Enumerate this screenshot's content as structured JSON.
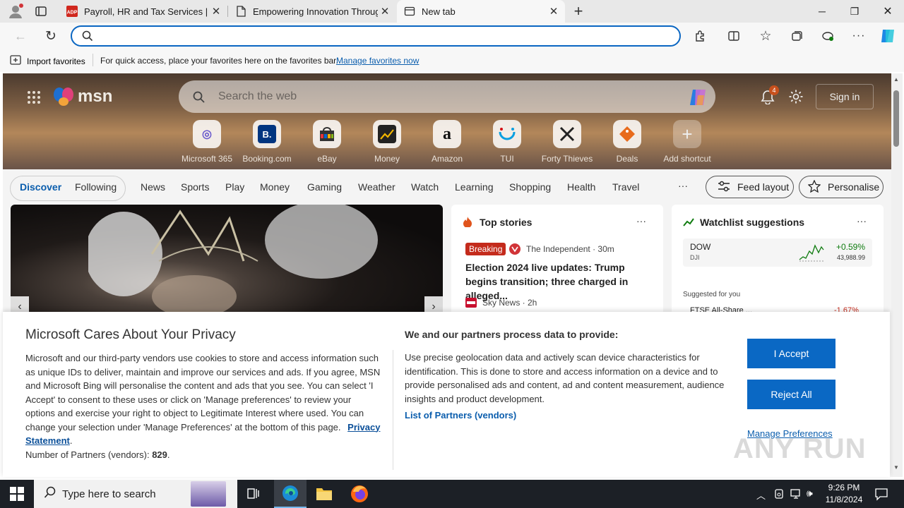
{
  "tabs": [
    {
      "title": "Payroll, HR and Tax Services | ADP",
      "icon": "adp-icon"
    },
    {
      "title": "Empowering Innovation Through",
      "icon": "page-icon"
    },
    {
      "title": "New tab",
      "icon": "newtab-icon"
    }
  ],
  "address": {
    "value": "",
    "placeholder": ""
  },
  "favorites_bar": {
    "import": "Import favorites",
    "message": "For quick access, place your favorites here on the favorites bar.",
    "manage_link": "Manage favorites now"
  },
  "msn": {
    "logo": "msn",
    "search_placeholder": "Search the web",
    "notification_count": "4",
    "sign_in": "Sign in",
    "shortcuts": [
      {
        "label": "Microsoft 365",
        "glyph": "◎",
        "color": "#6a5acd"
      },
      {
        "label": "Booking.com",
        "glyph": "B.",
        "color": "#003580"
      },
      {
        "label": "eBay",
        "glyph": "▤",
        "color": "#e53238"
      },
      {
        "label": "Money",
        "glyph": "▲",
        "color": "#2c2c2c"
      },
      {
        "label": "Amazon",
        "glyph": "a",
        "color": "#111"
      },
      {
        "label": "TUI",
        "glyph": "◡",
        "color": "#0a9fe0"
      },
      {
        "label": "Forty Thieves",
        "glyph": "✕",
        "color": "#222"
      },
      {
        "label": "Deals",
        "glyph": "◆",
        "color": "#e86b1c"
      },
      {
        "label": "Add shortcut",
        "glyph": "+",
        "color": "#555"
      }
    ],
    "feed_tabs": [
      "Discover",
      "Following"
    ],
    "categories": [
      "News",
      "Sports",
      "Play",
      "Money",
      "Gaming",
      "Weather",
      "Watch",
      "Learning",
      "Shopping",
      "Health",
      "Travel"
    ],
    "more": "···",
    "feed_layout": "Feed layout",
    "personalise": "Personalise"
  },
  "top_stories": {
    "title": "Top stories",
    "badge": "Breaking",
    "source1": "The Independent · 30m",
    "headline": "Election 2024 live updates: Trump begins transition; three charged in alleged...",
    "source2": "Sky News · 2h"
  },
  "watchlist": {
    "title": "Watchlist suggestions",
    "stock_name": "DOW",
    "stock_ticker": "DJI",
    "stock_change": "+0.59%",
    "stock_value": "43,988.99",
    "suggested": "Suggested for you",
    "partial_name": "FTSE All-Share ...",
    "partial_change": "-1.67%"
  },
  "privacy": {
    "title": "Microsoft Cares About Your Privacy",
    "body": "Microsoft and our third-party vendors use cookies to store and access information such as unique IDs to deliver, maintain and improve our services and ads. If you agree, MSN and Microsoft Bing will personalise the content and ads that you see. You can select 'I Accept' to consent to these uses or click on 'Manage preferences' to review your options and exercise your right to object to Legitimate Interest where used.  You can change your selection under 'Manage Preferences' at the bottom of this page.",
    "privacy_link": "Privacy Statement",
    "partners_label": "Number of Partners (vendors):",
    "partners_count": "829",
    "right_title": "We and our partners process data to provide:",
    "right_body": "Use precise geolocation data and actively scan device characteristics for identification. This is done to store and access information on a device and to provide personalised ads and content, ad and content measurement, audience insights and product development.",
    "partners_link": "List of Partners (vendors)",
    "accept": "I Accept",
    "reject": "Reject All",
    "manage": "Manage Preferences"
  },
  "watermark": "ANY RUN",
  "taskbar": {
    "search_placeholder": "Type here to search",
    "time": "9:26 PM",
    "date": "11/8/2024"
  },
  "colors": {
    "accent": "#0a68c4",
    "breaking": "#c42b1c",
    "positive": "#107c10"
  }
}
